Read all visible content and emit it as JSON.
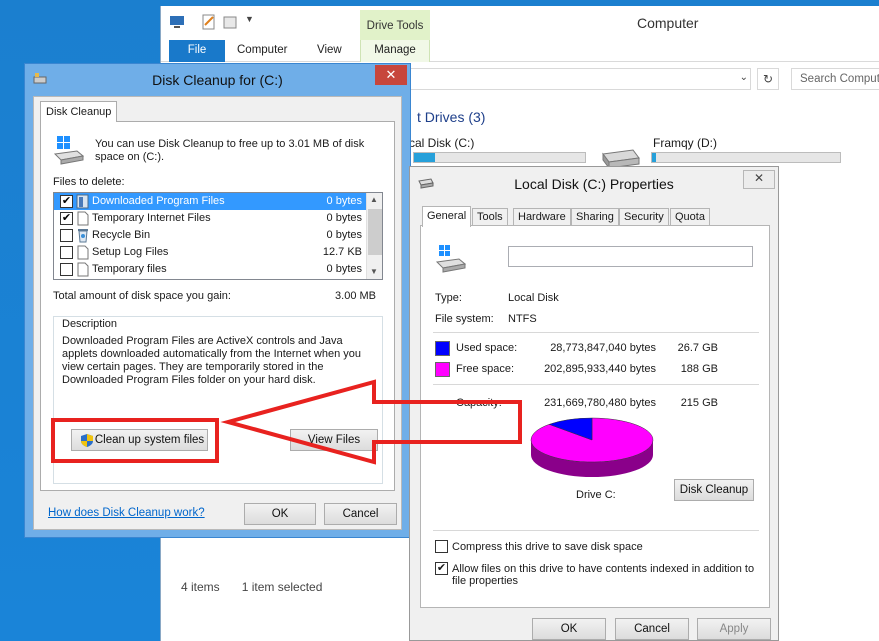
{
  "explorer": {
    "title": "Computer",
    "drive_tools": "Drive Tools",
    "tabs": {
      "file": "File",
      "computer": "Computer",
      "view": "View",
      "manage": "Manage"
    },
    "search_placeholder": "Search Comput",
    "drives_header": "t Drives (3)",
    "drive_c_label": "cal Disk (C:)",
    "drive_d_label": "Framqy (D:)",
    "status": {
      "items": "4 items",
      "selected": "1 item selected"
    }
  },
  "cleanup": {
    "title": "Disk Cleanup for  (C:)",
    "close": "✕",
    "tab": "Disk Cleanup",
    "intro": "You can use Disk Cleanup to free up to 3.01 MB of disk space on  (C:).",
    "files_label": "Files to delete:",
    "files": [
      {
        "name": "Downloaded Program Files",
        "size": "0 bytes",
        "checked": "✔"
      },
      {
        "name": "Temporary Internet Files",
        "size": "0 bytes",
        "checked": "✔"
      },
      {
        "name": "Recycle Bin",
        "size": "0 bytes",
        "checked": ""
      },
      {
        "name": "Setup Log Files",
        "size": "12.7 KB",
        "checked": ""
      },
      {
        "name": "Temporary files",
        "size": "0 bytes",
        "checked": ""
      }
    ],
    "total_label": "Total amount of disk space you gain:",
    "total_value": "3.00 MB",
    "description_label": "Description",
    "description": "Downloaded Program Files are ActiveX controls and Java applets downloaded automatically from the Internet when you view certain pages. They are temporarily stored in the Downloaded Program Files folder on your hard disk.",
    "cleanup_system_button": "Clean up system files",
    "view_files_button": "View Files",
    "how_link": "How does Disk Cleanup work?",
    "ok": "OK",
    "cancel": "Cancel"
  },
  "properties": {
    "title": "Local Disk (C:) Properties",
    "close": "✕",
    "tabs": [
      "General",
      "Tools",
      "Hardware",
      "Sharing",
      "Security",
      "Quota"
    ],
    "type_label": "Type:",
    "type_value": "Local Disk",
    "fs_label": "File system:",
    "fs_value": "NTFS",
    "used_label": "Used space:",
    "used_bytes": "28,773,847,040 bytes",
    "used_gb": "26.7 GB",
    "free_label": "Free space:",
    "free_bytes": "202,895,933,440 bytes",
    "free_gb": "188 GB",
    "capacity_label": "Capacity:",
    "capacity_bytes": "231,669,780,480 bytes",
    "capacity_gb": "215 GB",
    "used_fraction": 0.124,
    "used_color": "#0000ff",
    "free_color": "#ff00ff",
    "drive_label": "Drive C:",
    "disk_cleanup_button": "Disk Cleanup",
    "compress_label": "Compress this drive to save disk space",
    "compress_checked": "",
    "index_label": "Allow files on this drive to have contents indexed in addition to file properties",
    "index_checked": "✔",
    "ok": "OK",
    "cancel": "Cancel",
    "apply": "Apply"
  },
  "annotation_color": "#e8221f"
}
